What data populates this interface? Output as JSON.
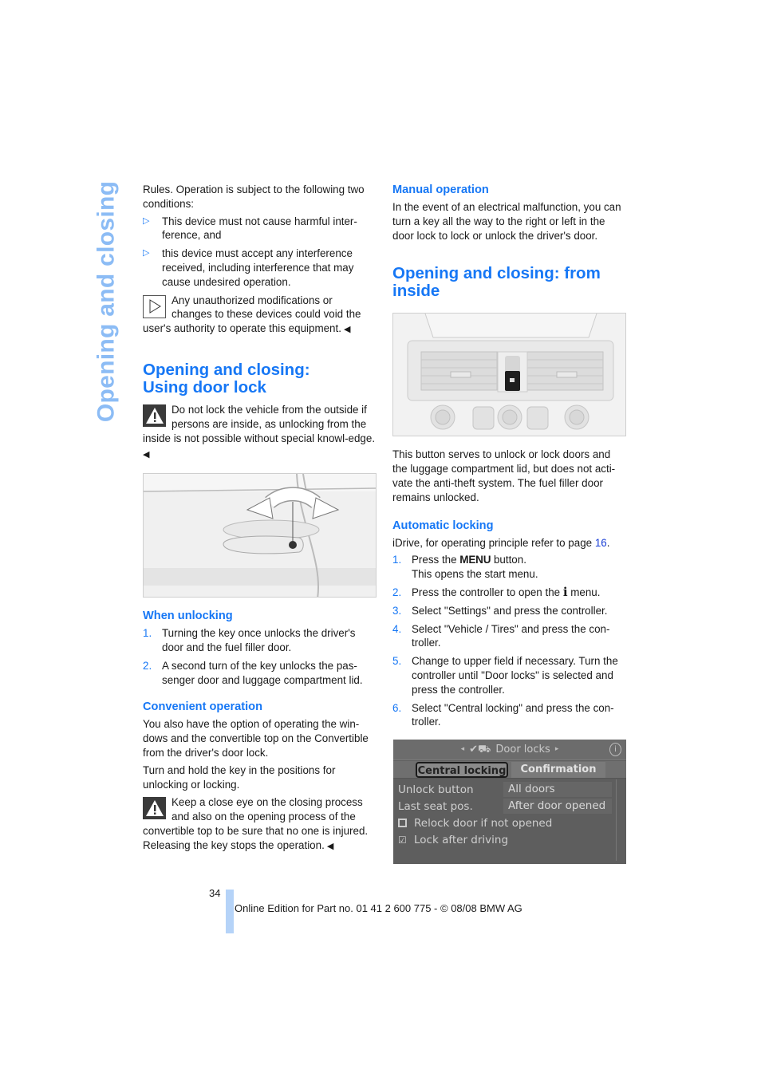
{
  "chapter_tab": "Opening and closing",
  "left_column": {
    "intro": "Rules. Operation is subject to the following two conditions:",
    "conditions": [
      "This device must not cause harmful inter-ference, and",
      "this device must accept any interference received, including interference that may cause undesired operation."
    ],
    "note": "Any unauthorized modifications or changes to these devices could void the user's authority to operate this equipment.",
    "section_heading_line1": "Opening and closing:",
    "section_heading_line2": "Using door lock",
    "warning1": "Do not lock the vehicle from the outside if persons are inside, as unlocking from the inside is not possible without special knowl-edge.",
    "figure1_alt": "Door handle with key lock and rotation arrows",
    "when_unlocking": {
      "heading": "When unlocking",
      "steps": [
        {
          "num": "1.",
          "text": "Turning the key once unlocks the driver's door and the fuel filler door."
        },
        {
          "num": "2.",
          "text": "A second turn of the key unlocks the pas-senger door and luggage compartment lid."
        }
      ]
    },
    "convenient_operation": {
      "heading": "Convenient operation",
      "para1": "You also have the option of operating the win-dows and the convertible top on the Convertible from the driver's door lock.",
      "para2": "Turn and hold the key in the positions for unlocking or locking."
    },
    "warning2": "Keep a close eye on the closing process and also on the opening process of the convertible top to be sure that no one is injured. Releasing the key stops the operation."
  },
  "right_column": {
    "manual_operation": {
      "heading": "Manual operation",
      "text": "In the event of an electrical malfunction, you can turn a key all the way to the right or left in the door lock to lock or unlock the driver's door."
    },
    "section_heading_line1": "Opening and closing: from",
    "section_heading_line2": "inside",
    "figure2_alt": "Center console with central locking button",
    "button_desc": "This button serves to unlock or lock doors and the luggage compartment lid, but does not acti-vate the anti-theft system. The fuel filler door remains unlocked.",
    "automatic_locking": {
      "heading": "Automatic locking",
      "intro_before": "iDrive, for operating principle refer to page ",
      "intro_page": "16",
      "intro_after": ".",
      "steps": [
        {
          "num": "1.",
          "before": "Press the ",
          "keyword": "MENU",
          "after": " button.",
          "sub": "This opens the start menu."
        },
        {
          "num": "2.",
          "before": "Press the controller to open the ",
          "keyword": "i",
          "after": " menu."
        },
        {
          "num": "3.",
          "text": "Select \"Settings\" and press the controller."
        },
        {
          "num": "4.",
          "text": "Select \"Vehicle / Tires\" and press the con-troller."
        },
        {
          "num": "5.",
          "text": "Change to upper field if necessary. Turn the controller until \"Door locks\" is selected and press the controller."
        },
        {
          "num": "6.",
          "text": "Select \"Central locking\" and press the con-troller."
        }
      ]
    },
    "idrive_screen": {
      "title": "Door locks",
      "tabs": [
        "Central locking",
        "Confirmation"
      ],
      "active_tab": "Central locking",
      "rows": [
        {
          "label": "Unlock button",
          "value": "All doors"
        },
        {
          "label": "Last seat pos.",
          "value": "After door opened"
        }
      ],
      "checkboxes": [
        {
          "label": "Relock door if not opened",
          "checked": false
        },
        {
          "label": "Lock after driving",
          "checked": true
        }
      ]
    }
  },
  "footer": {
    "page_number": "34",
    "edition": "Online Edition for Part no. 01 41 2 600 775 - © 08/08 BMW AG"
  },
  "colors": {
    "accent_blue": "#1677f5",
    "chapter_tab_blue": "#8cbcf5",
    "footer_bar_blue": "#b5d3f8",
    "link_blue": "#1a3fd6"
  }
}
